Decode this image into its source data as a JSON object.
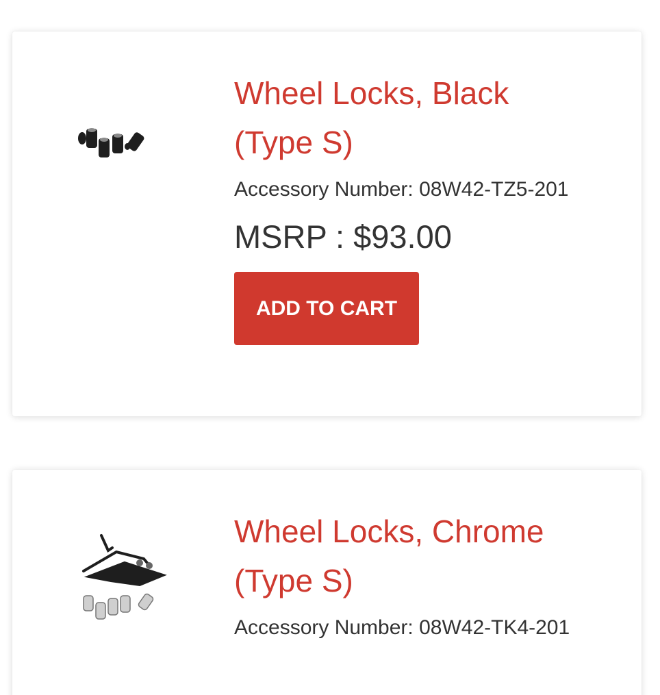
{
  "products": [
    {
      "title": "Wheel Locks, Black (Type S)",
      "accessory_number": "Accessory Number: 08W42-TZ5-201",
      "msrp": "MSRP : $93.00",
      "button_label": "ADD TO CART",
      "image_icon": "black-wheel-locks-product-image"
    },
    {
      "title": "Wheel Locks, Chrome (Type S)",
      "accessory_number": "Accessory Number: 08W42-TK4-201",
      "image_icon": "chrome-wheel-locks-product-image"
    }
  ],
  "colors": {
    "accent": "#cf3a30",
    "button": "#d0392e",
    "text": "#333333"
  }
}
